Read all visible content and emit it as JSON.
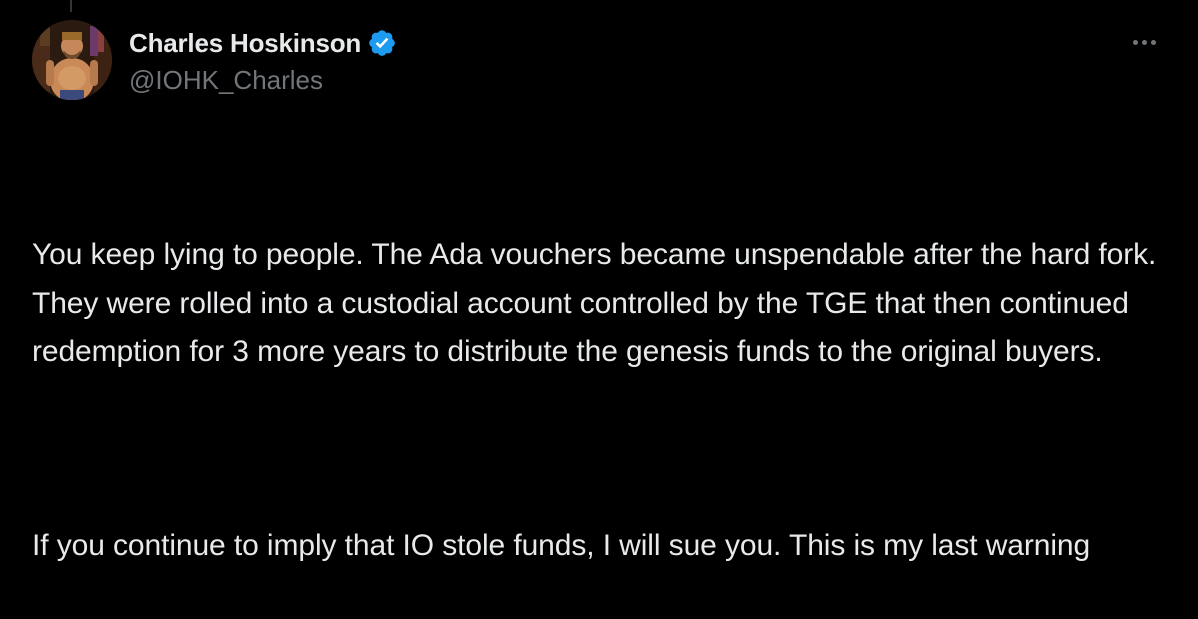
{
  "author": {
    "display_name": "Charles Hoskinson",
    "handle": "@IOHK_Charles",
    "verified": true,
    "verified_color": "#1d9bf0"
  },
  "tweet": {
    "paragraphs": [
      "You keep lying to people. The Ada vouchers became unspendable after the hard fork. They were rolled into a custodial account controlled by the TGE that then continued redemption for 3 more years to distribute the genesis funds to the original buyers.",
      "If you continue to imply that IO stole funds, I will sue you. This is my last warning"
    ]
  },
  "icons": {
    "verified": "verified-badge-icon",
    "more": "more-options-icon"
  },
  "colors": {
    "background": "#000000",
    "text": "#e7e9ea",
    "secondary_text": "#71767b"
  }
}
